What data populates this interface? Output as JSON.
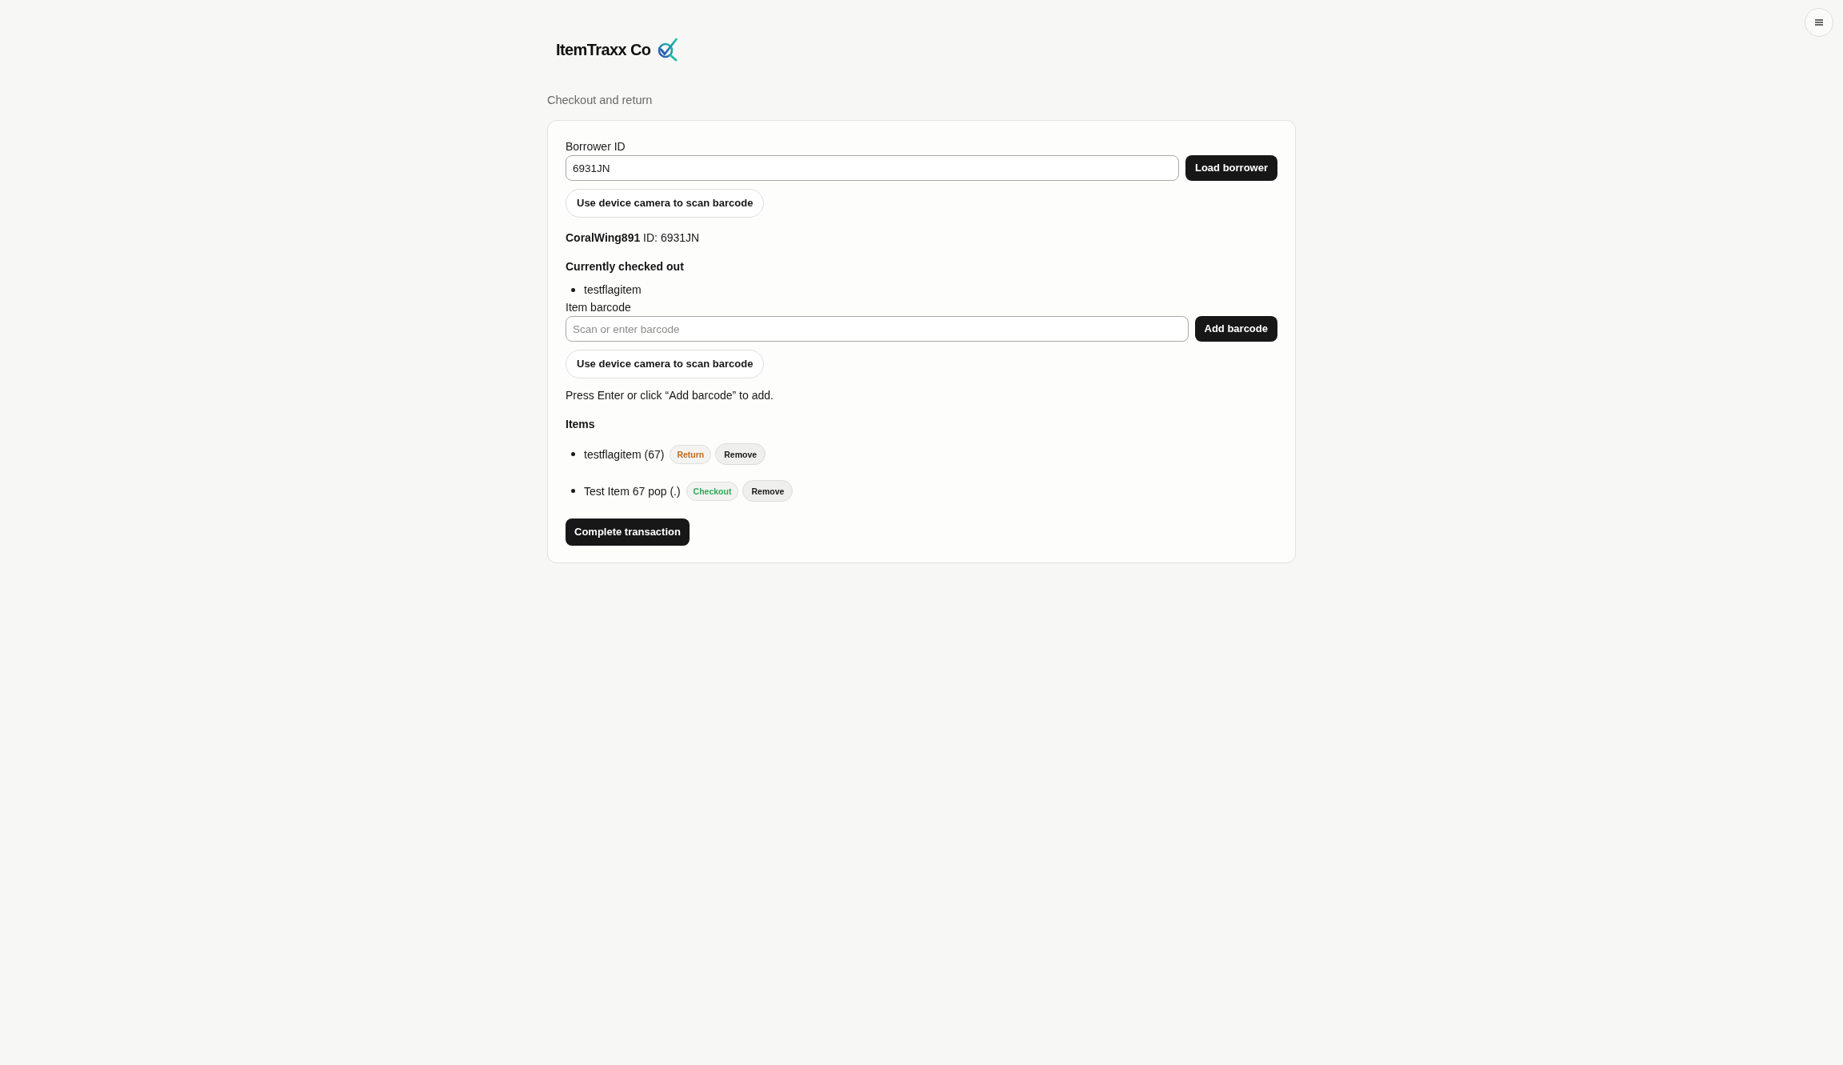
{
  "brand": {
    "name": "ItemTraxx Co"
  },
  "page_title": "Checkout and return",
  "borrower": {
    "label": "Borrower ID",
    "value": "6931JN",
    "load_button": "Load borrower",
    "scan_button": "Use device camera to scan barcode"
  },
  "borrower_summary": "**CoralWing891** ID: 6931JN",
  "checked_out": {
    "title": "Currently checked out",
    "items": [
      "testflagitem"
    ]
  },
  "barcode": {
    "label": "Item barcode",
    "placeholder": "Scan or enter barcode",
    "add_button": "Add barcode",
    "scan_button": "Use device camera to scan barcode"
  },
  "hint": "Press Enter or click “Add barcode” to add.",
  "items": {
    "title": "Items",
    "rows": [
      {
        "name": "testflagitem (67)",
        "action": "Return",
        "kind": "return",
        "remove": "Remove"
      },
      {
        "name": "Test Item 67 pop (.)",
        "action": "Checkout",
        "kind": "checkout",
        "remove": "Remove"
      }
    ]
  },
  "complete_button": "Complete transaction"
}
